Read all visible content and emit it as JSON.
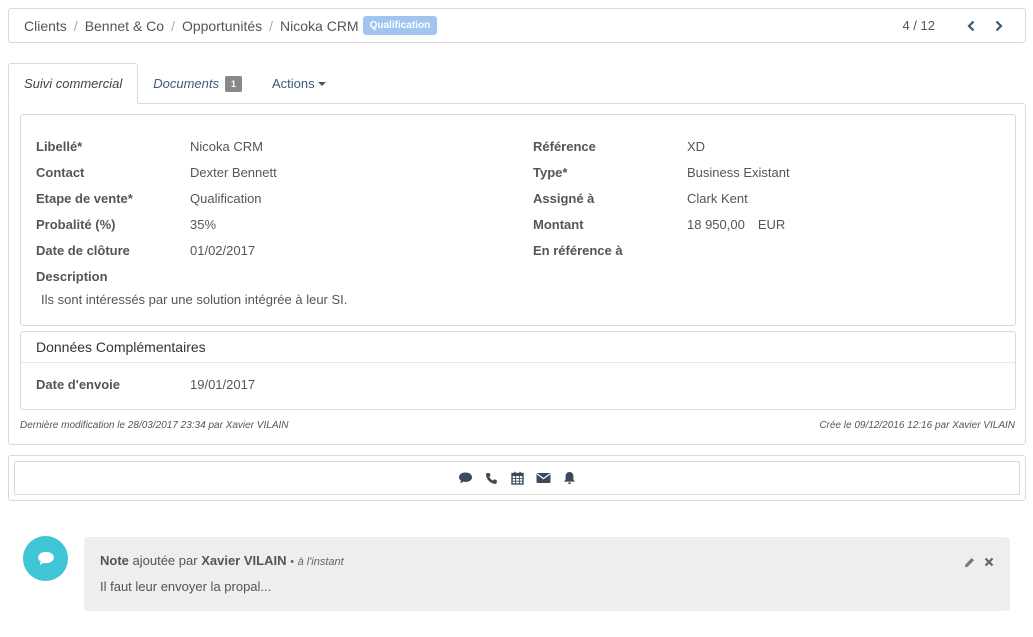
{
  "breadcrumb": {
    "items": [
      "Clients",
      "Bennet & Co",
      "Opportunités",
      "Nicoka CRM"
    ],
    "separator": "/",
    "stage_badge": "Qualification"
  },
  "pager": {
    "label": "4 / 12"
  },
  "tabs": {
    "suivi": "Suivi commercial",
    "documents": "Documents",
    "documents_count": "1",
    "actions": "Actions"
  },
  "details": {
    "left": [
      {
        "label": "Libellé*",
        "value": "Nicoka CRM"
      },
      {
        "label": "Contact",
        "value": "Dexter Bennett"
      },
      {
        "label": "Etape de vente*",
        "value": "Qualification"
      },
      {
        "label": "Probalité (%)",
        "value": "35%"
      },
      {
        "label": "Date de clôture",
        "value": "01/02/2017"
      }
    ],
    "right": [
      {
        "label": "Référence",
        "value": "XD"
      },
      {
        "label": "Type*",
        "value": "Business Existant"
      },
      {
        "label": "Assigné à",
        "value": "Clark Kent"
      },
      {
        "label": "Montant",
        "value": "18 950,00",
        "unit": "EUR"
      },
      {
        "label": "En référence à",
        "value": ""
      }
    ],
    "description_label": "Description",
    "description_value": "Ils sont intéressés par une solution intégrée à leur SI."
  },
  "extra": {
    "title": "Données Complémentaires",
    "field_label": "Date d'envoie",
    "field_value": "19/01/2017"
  },
  "meta": {
    "modified": "Dernière modification le 28/03/2017 23:34 par Xavier VILAIN",
    "created": "Crée le 09/12/2016 12:16 par Xavier VILAIN"
  },
  "activity_icons": [
    "comment-icon",
    "phone-icon",
    "calendar-icon",
    "envelope-icon",
    "bell-icon"
  ],
  "note": {
    "title_prefix": "Note",
    "title_mid": "ajoutée par",
    "author": "Xavier VILAIN",
    "time_sep": "•",
    "time": "à l'instant",
    "body": "Il faut leur envoyer la propal..."
  },
  "colors": {
    "stage_badge": "#9fc5f0",
    "avatar": "#3fc6d6",
    "note_bg": "#eeeeee"
  }
}
